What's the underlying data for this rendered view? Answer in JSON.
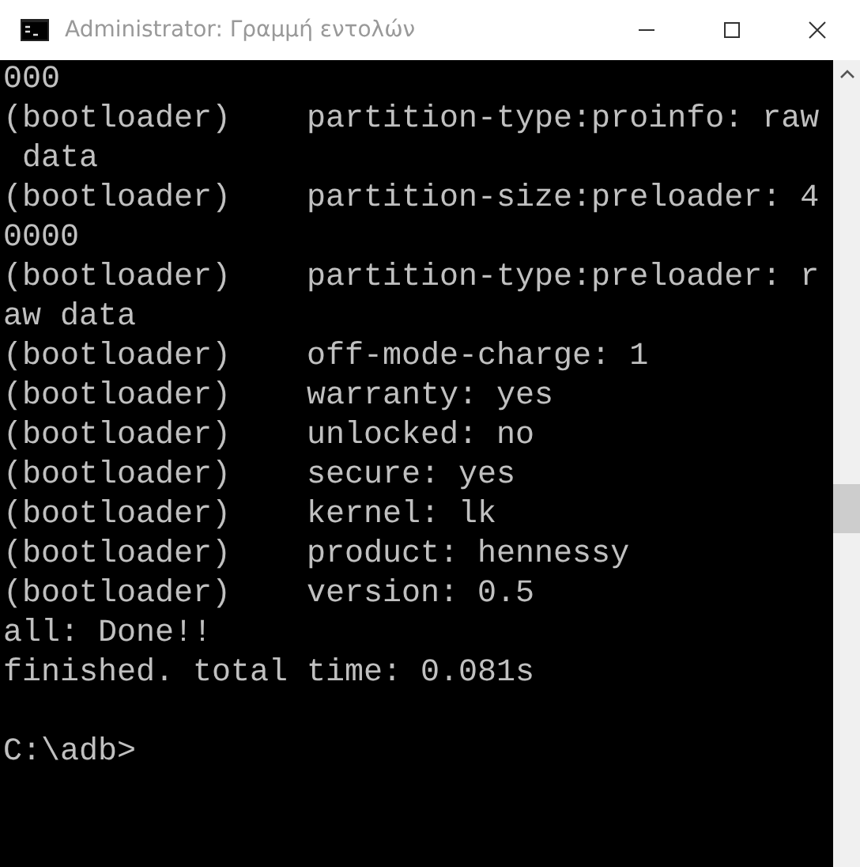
{
  "window": {
    "title": "Administrator: Γραμμή εντολών"
  },
  "console": {
    "lines": [
      "000",
      "(bootloader)    partition-type:proinfo: raw",
      " data",
      "(bootloader)    partition-size:preloader: 4",
      "0000",
      "(bootloader)    partition-type:preloader: r",
      "aw data",
      "(bootloader)    off-mode-charge: 1",
      "(bootloader)    warranty: yes",
      "(bootloader)    unlocked: no",
      "(bootloader)    secure: yes",
      "(bootloader)    kernel: lk",
      "(bootloader)    product: hennessy",
      "(bootloader)    version: 0.5",
      "all: Done!!",
      "finished. total time: 0.081s"
    ],
    "prompt": "C:\\adb>"
  }
}
